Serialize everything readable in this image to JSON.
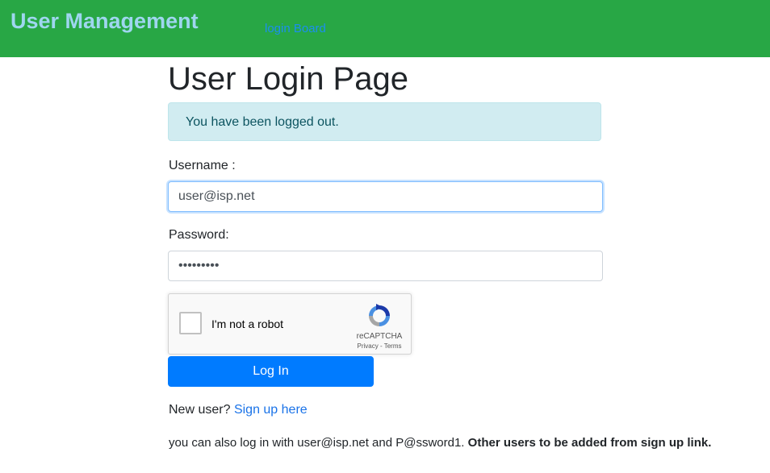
{
  "navbar": {
    "brand": "User Management",
    "link": "login Board",
    "background_color": "#28a745",
    "brand_color": "#9fd6ef"
  },
  "main": {
    "title": "User Login Page",
    "alert": "You have been logged out.",
    "username_label": "Username :",
    "username_value": "user@isp.net",
    "password_label": "Password:",
    "password_value": "P@ssword1",
    "login_button": "Log In",
    "signup_prompt": "New user?",
    "signup_link": "Sign up here",
    "info_text": "you can also log in with user@isp.net and P@ssword1.",
    "info_bold": "Other users to be added from sign up link."
  },
  "recaptcha": {
    "label": "I'm not a robot",
    "brand": "reCAPTCHA",
    "privacy": "Privacy",
    "separator": " - ",
    "terms": "Terms",
    "checked": false,
    "logo_icon": "recaptcha-logo-icon"
  },
  "colors": {
    "primary_button": "#007bff",
    "alert_background": "#d1ecf1",
    "alert_text": "#0c5460",
    "link": "#1a73e8"
  }
}
